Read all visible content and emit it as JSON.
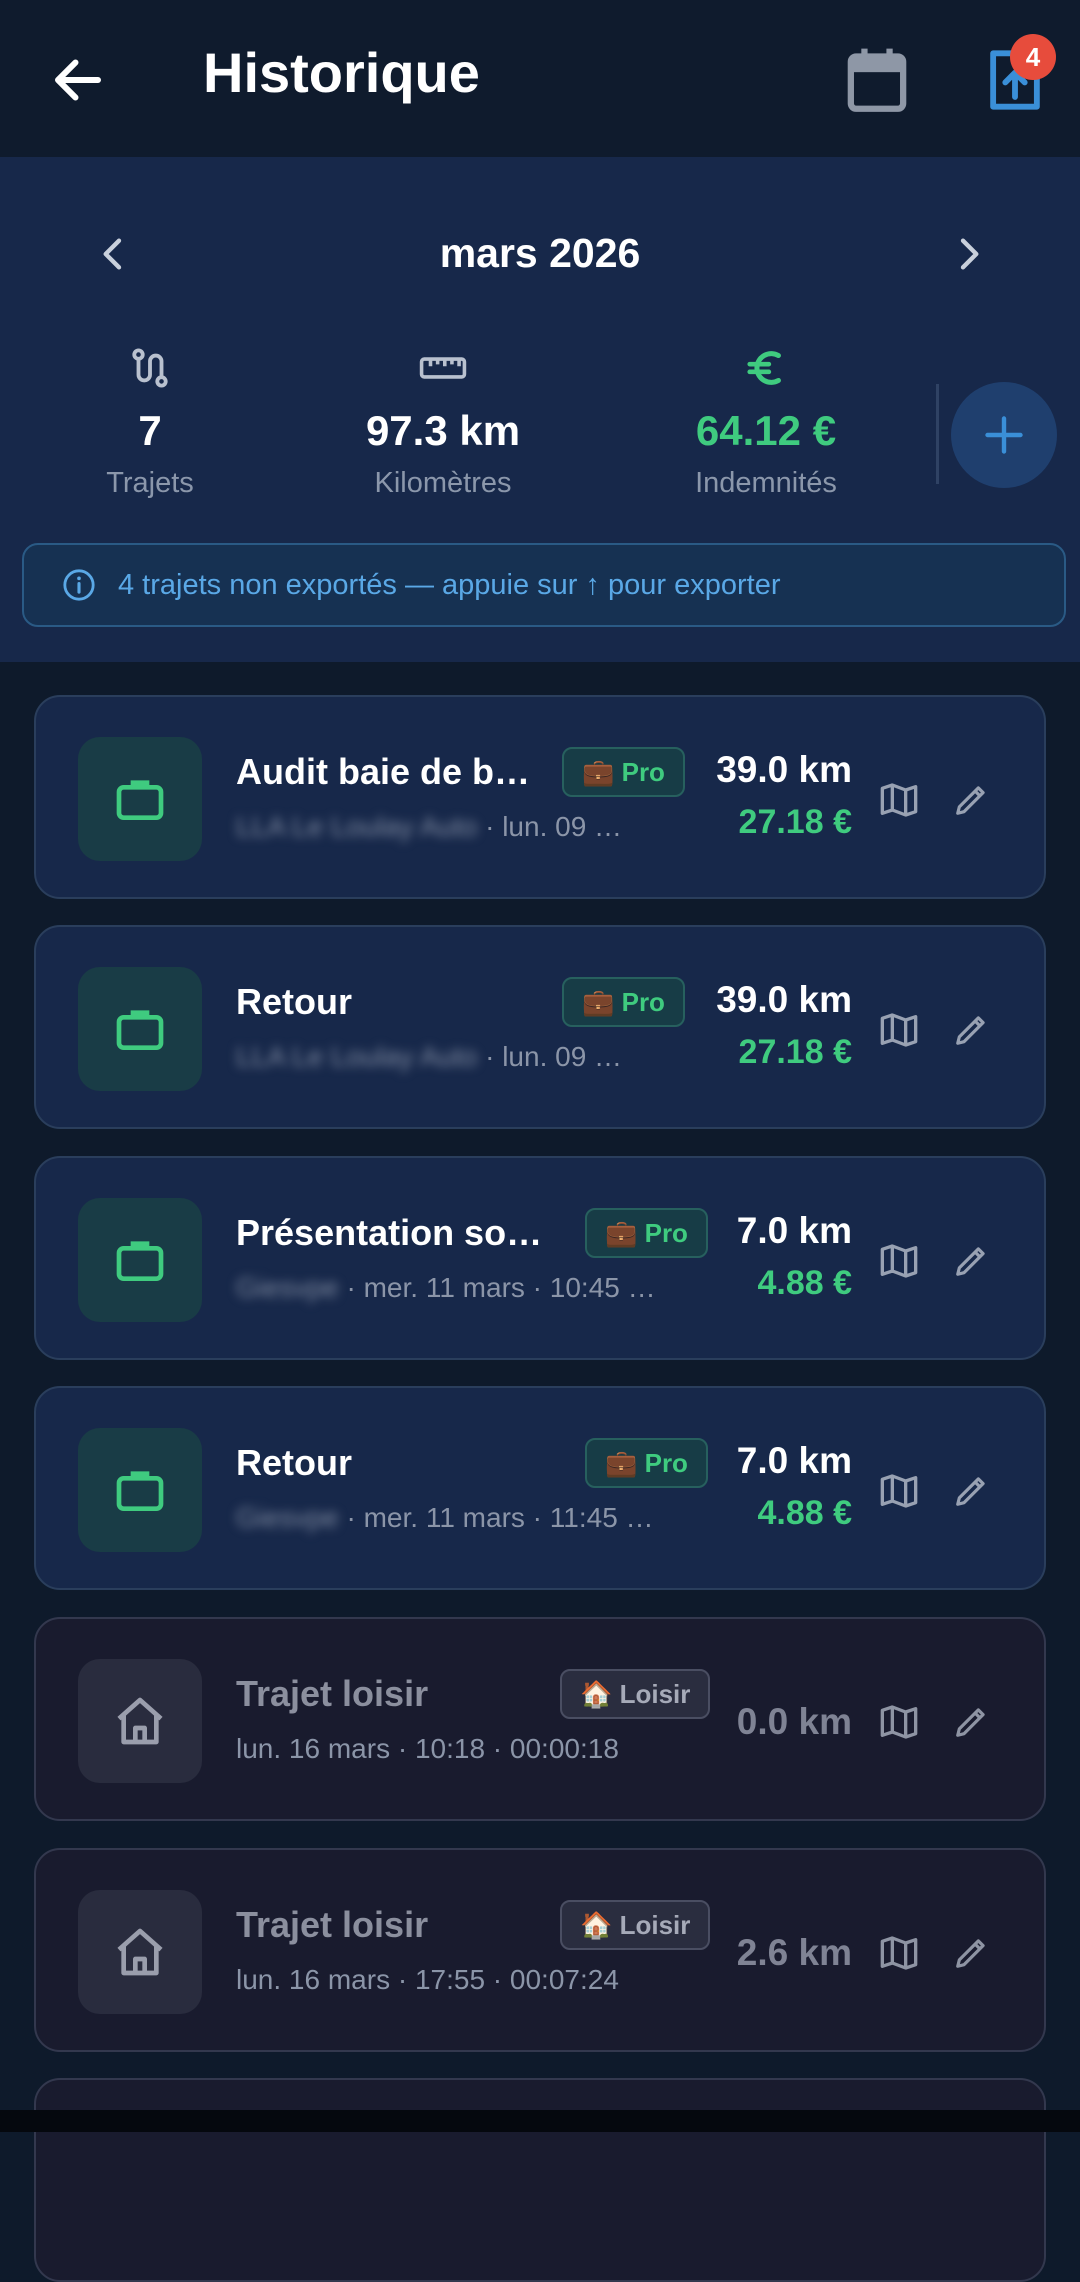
{
  "header": {
    "title": "Historique",
    "badge": "4"
  },
  "month": {
    "label": "mars 2026"
  },
  "stats": [
    {
      "icon": "route-icon",
      "value": "7",
      "label": "Trajets"
    },
    {
      "icon": "ruler-icon",
      "value": "97.3 km",
      "label": "Kilomètres"
    },
    {
      "icon": "euro-icon",
      "value": "64.12 €",
      "label": "Indemnités"
    }
  ],
  "info": {
    "text": "4 trajets non exportés — appuie sur ↑ pour exporter"
  },
  "trips": [
    {
      "type": "pro",
      "title": "Audit baie de b…",
      "tag": "💼 Pro",
      "sub_blur": "LLA Le Loulay Auto",
      "sub": " · lun. 09 …",
      "km": "39.0 km",
      "eur": "27.18 €"
    },
    {
      "type": "pro",
      "title": "Retour",
      "tag": "💼 Pro",
      "sub_blur": "LLA Le Loulay Auto",
      "sub": " · lun. 09 …",
      "km": "39.0 km",
      "eur": "27.18 €"
    },
    {
      "type": "pro",
      "title": "Présentation so…",
      "tag": "💼 Pro",
      "sub_blur": "Giesvpe",
      "sub": " · mer. 11 mars · 10:45 …",
      "km": "7.0 km",
      "eur": "4.88 €"
    },
    {
      "type": "pro",
      "title": "Retour",
      "tag": "💼 Pro",
      "sub_blur": "Giesvpe",
      "sub": " · mer. 11 mars · 11:45 …",
      "km": "7.0 km",
      "eur": "4.88 €"
    },
    {
      "type": "leisure",
      "title": "Trajet loisir",
      "tag": "🏠 Loisir",
      "sub": "lun. 16 mars · 10:18 · 00:00:18",
      "km": "0.0 km"
    },
    {
      "type": "leisure",
      "title": "Trajet loisir",
      "tag": "🏠 Loisir",
      "sub": "lun. 16 mars · 17:55 · 00:07:24",
      "km": "2.6 km"
    }
  ]
}
